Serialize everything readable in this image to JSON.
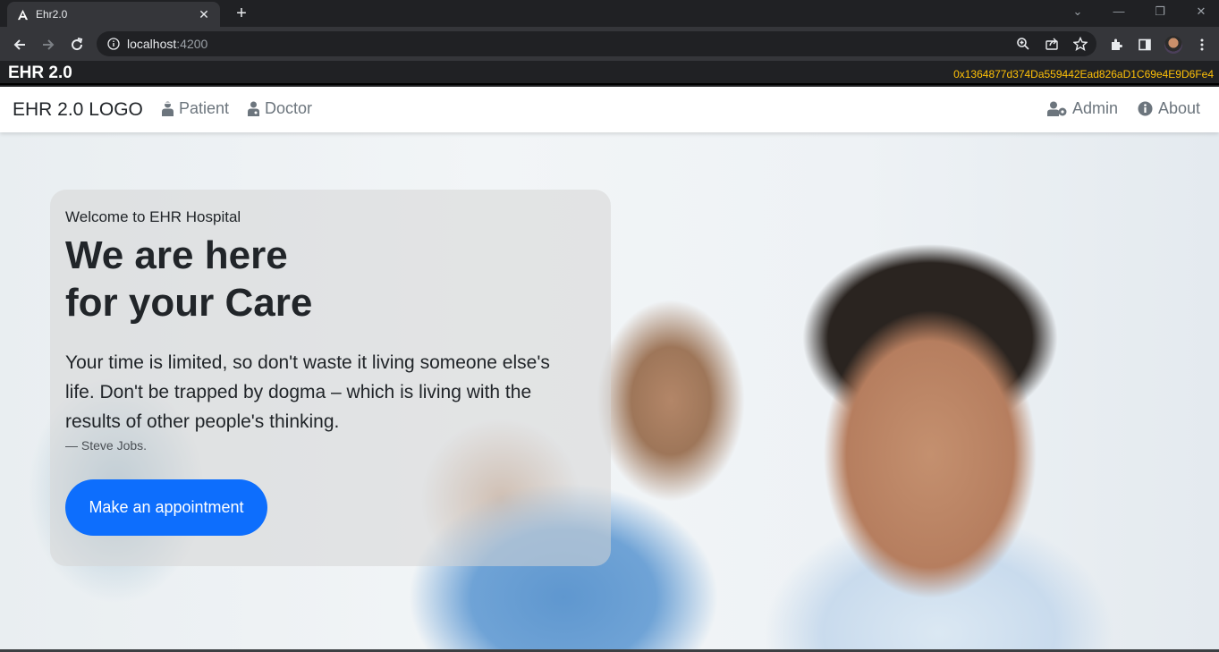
{
  "browser": {
    "tab_title": "Ehr2.0",
    "url_host": "localhost",
    "url_port": ":4200"
  },
  "app": {
    "brand": "EHR 2.0",
    "account_address": "0x1364877d374Da559442Ead826aD1C69e4E9D6Fe4"
  },
  "navbar": {
    "logo": "EHR 2.0 LOGO",
    "links_left": [
      {
        "label": "Patient",
        "icon": "user-injured-icon"
      },
      {
        "label": "Doctor",
        "icon": "user-doctor-icon"
      }
    ],
    "links_right": [
      {
        "label": "Admin",
        "icon": "user-gear-icon"
      },
      {
        "label": "About",
        "icon": "info-circle-icon"
      }
    ]
  },
  "hero": {
    "kicker": "Welcome to EHR Hospital",
    "headline_line1": "We are here",
    "headline_line2": "for your Care",
    "quote": "Your time is limited, so don't waste it living someone else's life. Don't be trapped by dogma – which is living with the results of other people's thinking.",
    "cite": "—  Steve Jobs.",
    "cta": "Make an appointment"
  },
  "colors": {
    "primary": "#0d6efd",
    "address": "#ffc107",
    "chrome_dark": "#202124"
  }
}
